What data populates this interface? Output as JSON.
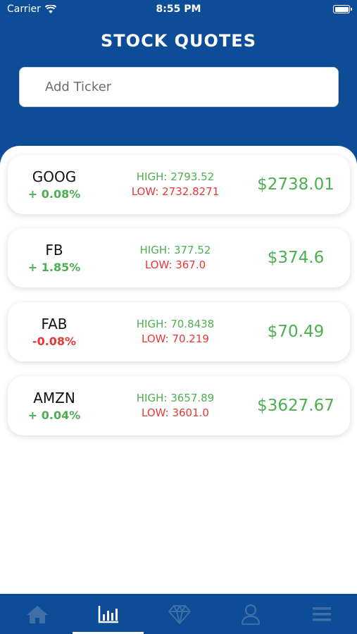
{
  "status_bar": {
    "carrier": "Carrier",
    "time": "8:55 PM"
  },
  "header": {
    "title": "STOCK QUOTES"
  },
  "search": {
    "placeholder": "Add Ticker"
  },
  "colors": {
    "brand_blue": "#0d4d97",
    "positive": "#4caf50",
    "negative": "#e53935"
  },
  "quotes": [
    {
      "symbol": "GOOG",
      "change": "+ 0.08%",
      "direction": "up",
      "high": "HIGH: 2793.52",
      "low": "LOW: 2732.8271",
      "price": "$2738.01"
    },
    {
      "symbol": "FB",
      "change": "+ 1.85%",
      "direction": "up",
      "high": "HIGH: 377.52",
      "low": "LOW: 367.0",
      "price": "$374.6"
    },
    {
      "symbol": "FAB",
      "change": "-0.08%",
      "direction": "down",
      "high": "HIGH: 70.8438",
      "low": "LOW: 70.219",
      "price": "$70.49"
    },
    {
      "symbol": "AMZN",
      "change": "+ 0.04%",
      "direction": "up",
      "high": "HIGH: 3657.89",
      "low": "LOW: 3601.0",
      "price": "$3627.67"
    }
  ],
  "tabs": [
    {
      "icon": "home-icon",
      "active": false
    },
    {
      "icon": "bar-chart-icon",
      "active": true
    },
    {
      "icon": "diamond-icon",
      "active": false
    },
    {
      "icon": "user-icon",
      "active": false
    },
    {
      "icon": "menu-icon",
      "active": false
    }
  ]
}
